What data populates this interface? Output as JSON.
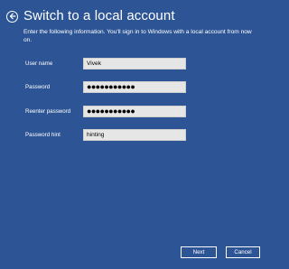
{
  "header": {
    "title": "Switch to a local account",
    "back_icon": "back-arrow-icon"
  },
  "description": "Enter the following information. You'll sign in to Windows with a local account from now on.",
  "form": {
    "user_name": {
      "label": "User name",
      "value": "Vivek"
    },
    "password": {
      "label": "Password",
      "value": "●●●●●●●●●●●"
    },
    "reenter_password": {
      "label": "Reenter password",
      "value": "●●●●●●●●●●●"
    },
    "password_hint": {
      "label": "Password hint",
      "value": "hinting"
    }
  },
  "buttons": {
    "next": "Next",
    "cancel": "Cancel"
  },
  "colors": {
    "background": "#2d5595",
    "text": "#ffffff",
    "input_background": "#e6e6e6"
  }
}
